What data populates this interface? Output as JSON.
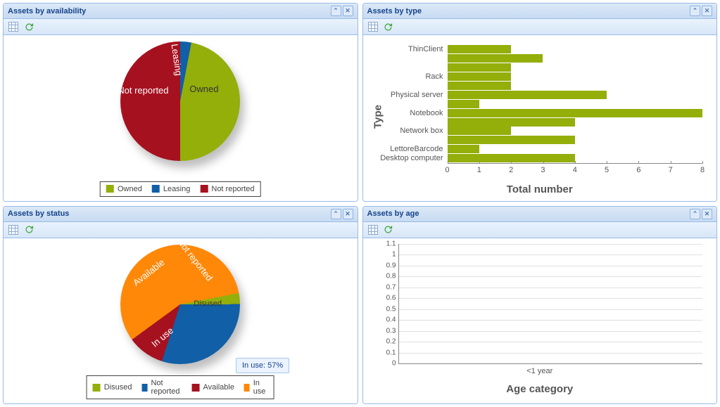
{
  "colors": {
    "green": "#94ae0a",
    "blue": "#115fa6",
    "red": "#a61120",
    "orange": "#ff8809"
  },
  "panels": {
    "availability": {
      "title": "Assets by availability"
    },
    "type": {
      "title": "Assets by type"
    },
    "status": {
      "title": "Assets by status"
    },
    "age": {
      "title": "Assets by age"
    }
  },
  "availability": {
    "legend": {
      "owned": "Owned",
      "leasing": "Leasing",
      "not_reported": "Not reported"
    },
    "slice_labels": {
      "owned": "Owned",
      "leasing": "Leasing",
      "not_reported": "Not reported"
    }
  },
  "status": {
    "legend": {
      "disused": "Disused",
      "not_reported": "Not reported",
      "available": "Available",
      "in_use": "In use"
    },
    "slice_labels": {
      "disused": "Disused",
      "not_reported": "Not reported",
      "available": "Available",
      "in_use": "In use"
    },
    "tooltip": "In use: 57%"
  },
  "type": {
    "ylabel": "Type",
    "xlabel": "Total number",
    "categories": [
      "ThinClient",
      "",
      "",
      "Rack",
      "",
      "Physical server",
      "",
      "Notebook",
      "",
      "Network box",
      "",
      "LettoreBarcode",
      "Desktop computer"
    ],
    "ticks": [
      "0",
      "1",
      "2",
      "3",
      "4",
      "5",
      "6",
      "7",
      "8"
    ]
  },
  "age": {
    "xlabel": "Age category",
    "xtick": "<1 year",
    "yticks": [
      "0",
      "0.1",
      "0.2",
      "0.3",
      "0.4",
      "0.5",
      "0.6",
      "0.7",
      "0.8",
      "0.9",
      "1",
      "1.1"
    ]
  },
  "chart_data": [
    {
      "id": "assets_by_availability",
      "type": "pie",
      "title": "Assets by availability",
      "series": [
        {
          "name": "Owned",
          "value": 47,
          "color": "#94ae0a"
        },
        {
          "name": "Leasing",
          "value": 3,
          "color": "#115fa6"
        },
        {
          "name": "Not reported",
          "value": 50,
          "color": "#a61120"
        }
      ]
    },
    {
      "id": "assets_by_type",
      "type": "bar",
      "orientation": "horizontal",
      "title": "Assets by type",
      "xlabel": "Total number",
      "ylabel": "Type",
      "xlim": [
        0,
        8
      ],
      "categories": [
        "ThinClient",
        "(unlabeled 1)",
        "(unlabeled 2)",
        "Rack",
        "(unlabeled 3)",
        "Physical server",
        "(unlabeled 4)",
        "Notebook",
        "(unlabeled 5)",
        "Network box",
        "(unlabeled 6)",
        "LettoreBarcode",
        "Desktop computer"
      ],
      "values": [
        2,
        3,
        2,
        2,
        2,
        5,
        1,
        8,
        4,
        2,
        4,
        1,
        4
      ]
    },
    {
      "id": "assets_by_status",
      "type": "pie",
      "title": "Assets by status",
      "series": [
        {
          "name": "Disused",
          "value": 3,
          "color": "#94ae0a"
        },
        {
          "name": "Not reported",
          "value": 30,
          "color": "#115fa6"
        },
        {
          "name": "Available",
          "value": 10,
          "color": "#a61120"
        },
        {
          "name": "In use",
          "value": 57,
          "color": "#ff8809"
        }
      ],
      "annotations": [
        "In use: 57%"
      ]
    },
    {
      "id": "assets_by_age",
      "type": "bar",
      "title": "Assets by age",
      "xlabel": "Age category",
      "ylabel": "",
      "ylim": [
        0,
        1.1
      ],
      "categories": [
        "<1 year"
      ],
      "values": []
    }
  ]
}
